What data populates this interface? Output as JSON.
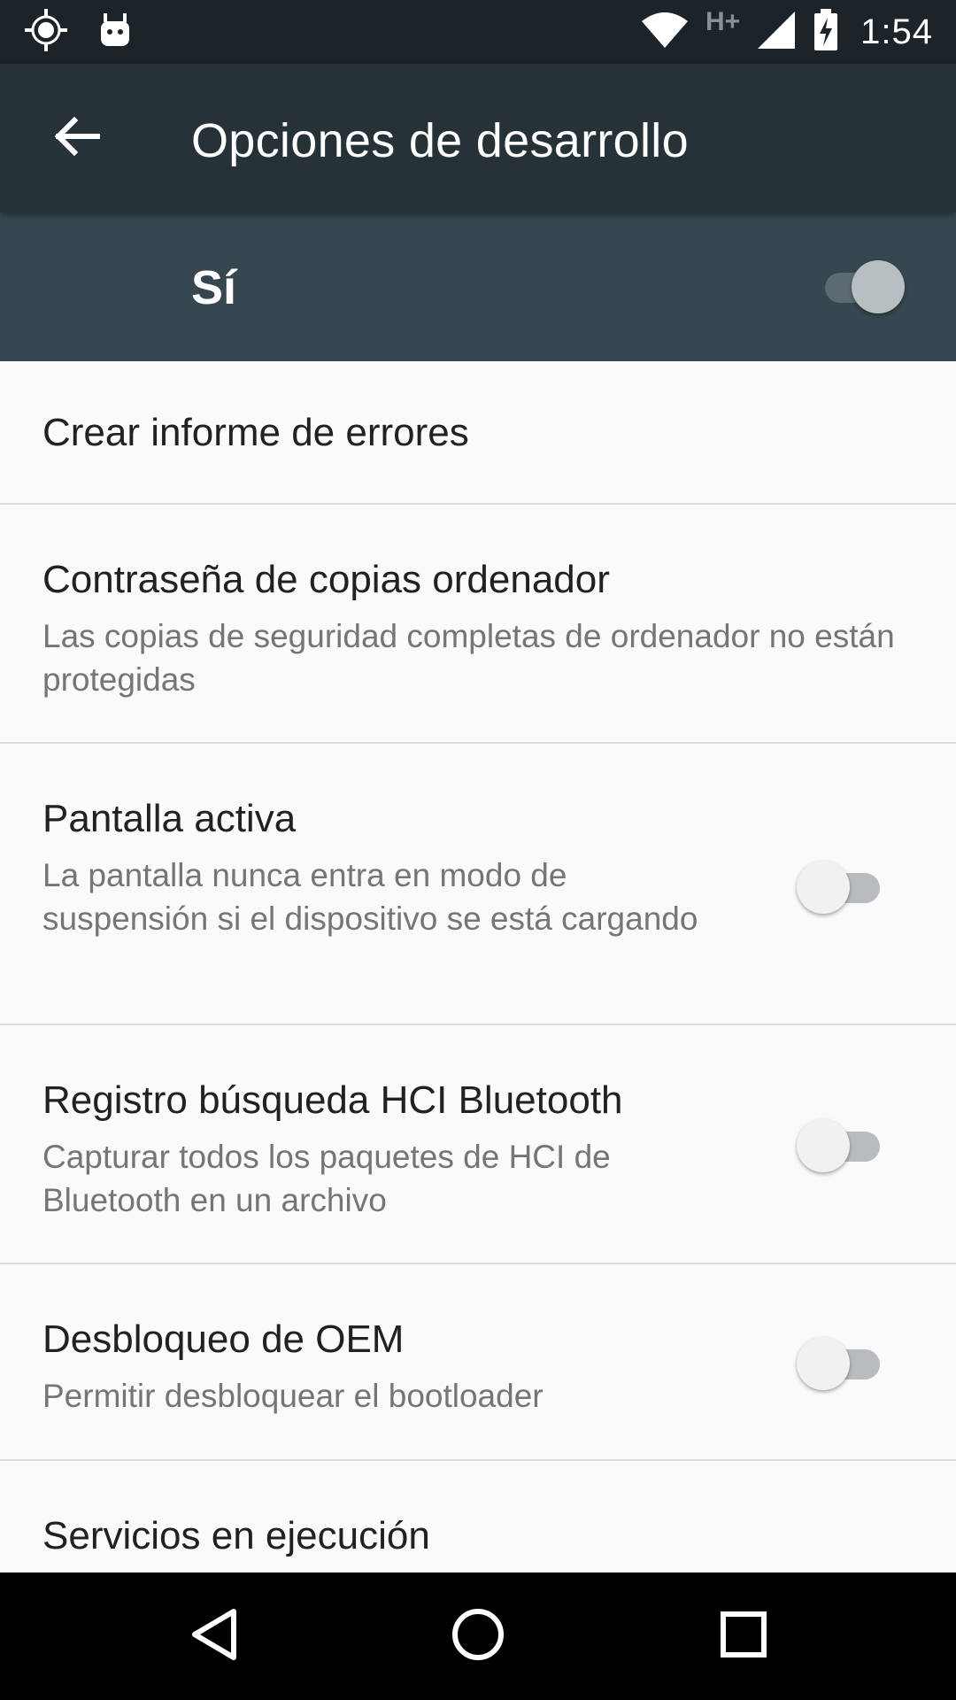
{
  "status_bar": {
    "time": "1:54",
    "network_type": "H+",
    "left_icons": [
      "gps-icon",
      "android-debug-icon"
    ],
    "right_icons": [
      "wifi-icon",
      "cell-signal-icon",
      "battery-charging-icon"
    ]
  },
  "toolbar": {
    "title": "Opciones de desarrollo",
    "back_icon": "arrow-left-icon"
  },
  "master_switch": {
    "label": "Sí",
    "checked": true
  },
  "preferences": [
    {
      "title": "Crear informe de errores",
      "summary": ""
    },
    {
      "title": "Contraseña de copias ordenador",
      "summary": "Las copias de seguridad completas de ordenador no están protegidas"
    },
    {
      "title": "Pantalla activa",
      "summary": "La pantalla nunca entra en modo de suspensión si el dispositivo se está cargando",
      "switch": true,
      "checked": false
    },
    {
      "title": "Registro búsqueda HCI Bluetooth",
      "summary": "Capturar todos los paquetes de HCI de Bluetooth en un archivo",
      "switch": true,
      "checked": false
    },
    {
      "title": "Desbloqueo de OEM",
      "summary": "Permitir desbloquear el bootloader",
      "switch": true,
      "checked": false
    },
    {
      "title": "Servicios en ejecución",
      "summary": ""
    }
  ],
  "nav_bar": {
    "icons": [
      "back-triangle-icon",
      "home-circle-icon",
      "recents-square-icon"
    ]
  },
  "colors": {
    "status_bar": "#1c2429",
    "toolbar": "#263238",
    "master_bar": "#37474f",
    "background": "#fafafa",
    "title_text": "#212121",
    "summary_text": "#757575"
  }
}
